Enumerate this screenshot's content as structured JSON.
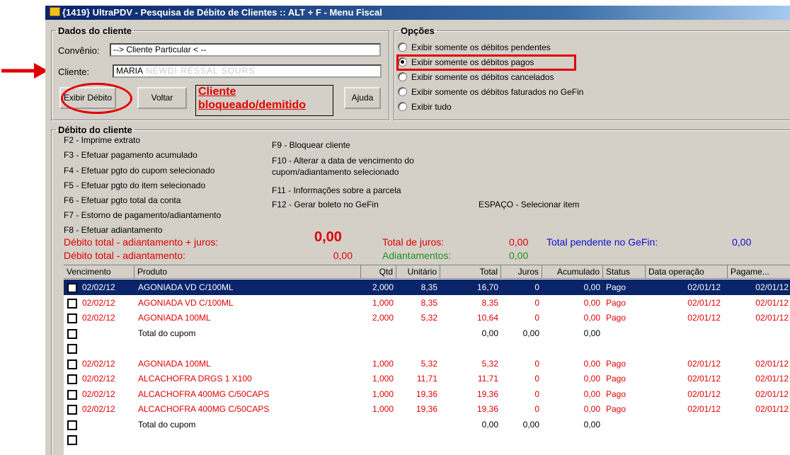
{
  "window": {
    "title": "{1419} UltraPDV - Pesquisa de Débito de Clientes :: ALT + F - Menu Fiscal"
  },
  "dados": {
    "legend": "Dados do cliente",
    "convenio_label": "Convênio:",
    "convenio_value": "--> Cliente Particular < --",
    "cliente_label": "Cliente:",
    "cliente_value": "MARIA",
    "cliente_blurred": "NEWDI RESSAL SOURS",
    "exibir_label": "Exibir Débito",
    "voltar_label": "Voltar",
    "bloqueado_text": "Cliente bloqueado/demitido",
    "ajuda_label": "Ajuda"
  },
  "opcoes": {
    "legend": "Opções",
    "options": [
      {
        "label": "Exibir somente os débitos pendentes",
        "selected": false
      },
      {
        "label": "Exibir somente os débitos pagos",
        "selected": true
      },
      {
        "label": "Exibir somente os débitos cancelados",
        "selected": false
      },
      {
        "label": "Exibir somente os débitos faturados no GeFin",
        "selected": false
      },
      {
        "label": "Exibir tudo",
        "selected": false
      }
    ]
  },
  "debito": {
    "legend": "Débito do cliente",
    "help_left": [
      "F2 - Imprime extrato",
      "F3 - Efetuar pagamento acumulado",
      "F4 - Efetuar pgto do cupom selecionado",
      "F5 - Efetuar pgto do item selecionado",
      "F6 - Efetuar pgto total da conta",
      "F7 - Estorno de pagamento/adiantamento",
      "F8 - Efetuar adiantamento"
    ],
    "help_right": [
      "F9 - Bloquear cliente",
      "F10 - Alterar a data de vencimento do",
      "cupom/adiantamento selecionado",
      "F11 - Informações sobre a parcela",
      "F12 - Gerar boleto no GeFin"
    ],
    "espaco": "ESPAÇO - Selecionar item",
    "totals": {
      "debito_juros_label": "Débito total - adiantamento + juros:",
      "debito_juros_value": "0,00",
      "debito_label": "Débito total - adiantamento:",
      "debito_value": "0,00",
      "juros_label": "Total de juros:",
      "juros_value": "0,00",
      "adiant_label": "Adiantamentos:",
      "adiant_value": "0,00",
      "gefin_label": "Total pendente no GeFin:",
      "gefin_value": "0,00"
    }
  },
  "grid": {
    "columns": [
      "Vencimento",
      "Produto",
      "Qtd",
      "Unitário",
      "Total",
      "Juros",
      "Acumulado",
      "Status",
      "Data operação",
      "Pagame..."
    ],
    "rows": [
      {
        "venc": "02/02/12",
        "prod": "AGONIADA VD C/100ML",
        "qtd": "2,000",
        "unit": "8,35",
        "total": "16,70",
        "juros": "0",
        "acum": "0,00",
        "status": "Pago",
        "dataop": "02/01/12",
        "pag": "02/01/12",
        "style": "sel"
      },
      {
        "venc": "02/02/12",
        "prod": "AGONIADA VD C/100ML",
        "qtd": "1,000",
        "unit": "8,35",
        "total": "8,35",
        "juros": "0",
        "acum": "0,00",
        "status": "Pago",
        "dataop": "02/01/12",
        "pag": "02/01/12",
        "style": "red"
      },
      {
        "venc": "02/02/12",
        "prod": "AGONIADA 100ML",
        "qtd": "2,000",
        "unit": "5,32",
        "total": "10,64",
        "juros": "0",
        "acum": "0,00",
        "status": "Pago",
        "dataop": "02/01/12",
        "pag": "02/01/12",
        "style": "red"
      },
      {
        "venc": "",
        "prod": "Total do cupom",
        "qtd": "",
        "unit": "",
        "total": "0,00",
        "juros": "0,00",
        "acum": "0,00",
        "status": "",
        "dataop": "",
        "pag": "",
        "style": "black"
      },
      {
        "venc": "",
        "prod": "",
        "qtd": "",
        "unit": "",
        "total": "",
        "juros": "",
        "acum": "",
        "status": "",
        "dataop": "",
        "pag": "",
        "style": "black"
      },
      {
        "venc": "02/02/12",
        "prod": "AGONIADA 100ML",
        "qtd": "1,000",
        "unit": "5,32",
        "total": "5,32",
        "juros": "0",
        "acum": "0,00",
        "status": "Pago",
        "dataop": "02/01/12",
        "pag": "02/01/12",
        "style": "red"
      },
      {
        "venc": "02/02/12",
        "prod": "ALCACHOFRA DRGS 1 X100",
        "qtd": "1,000",
        "unit": "11,71",
        "total": "11,71",
        "juros": "0",
        "acum": "0,00",
        "status": "Pago",
        "dataop": "02/01/12",
        "pag": "02/01/12",
        "style": "red"
      },
      {
        "venc": "02/02/12",
        "prod": "ALCACHOFRA 400MG C/50CAPS",
        "qtd": "1,000",
        "unit": "19,36",
        "total": "19,36",
        "juros": "0",
        "acum": "0,00",
        "status": "Pago",
        "dataop": "02/01/12",
        "pag": "02/01/12",
        "style": "red"
      },
      {
        "venc": "02/02/12",
        "prod": "ALCACHOFRA 400MG C/50CAPS",
        "qtd": "1,000",
        "unit": "19,36",
        "total": "19,36",
        "juros": "0",
        "acum": "0,00",
        "status": "Pago",
        "dataop": "02/01/12",
        "pag": "02/01/12",
        "style": "red"
      },
      {
        "venc": "",
        "prod": "Total do cupom",
        "qtd": "",
        "unit": "",
        "total": "0,00",
        "juros": "0,00",
        "acum": "0,00",
        "status": "",
        "dataop": "",
        "pag": "",
        "style": "black"
      },
      {
        "venc": "",
        "prod": "",
        "qtd": "",
        "unit": "",
        "total": "",
        "juros": "",
        "acum": "",
        "status": "",
        "dataop": "",
        "pag": "",
        "style": "black"
      }
    ]
  },
  "colors": {
    "accent_red": "#e00000",
    "green": "#209020",
    "blue": "#1010d0",
    "selection": "#0a246a"
  }
}
